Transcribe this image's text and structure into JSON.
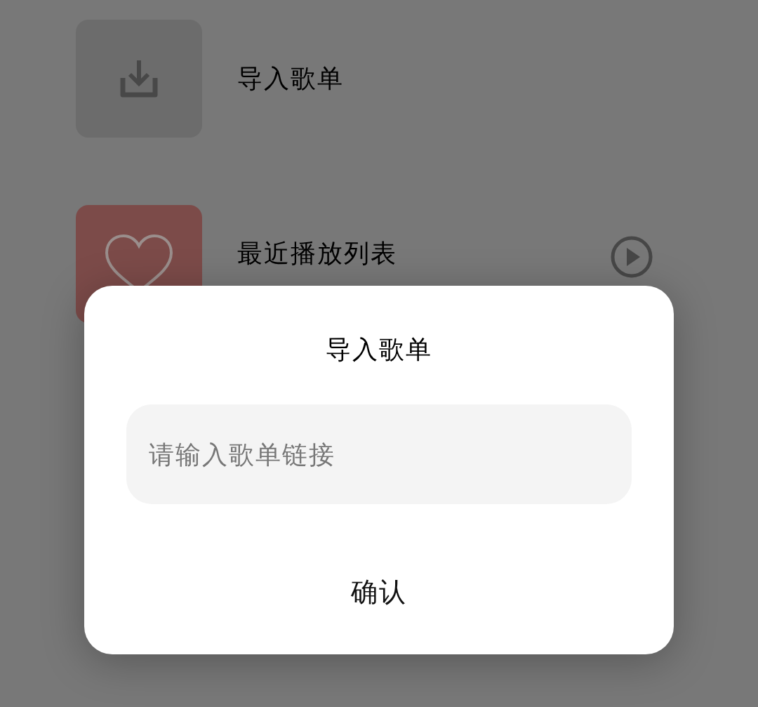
{
  "playlists": [
    {
      "kind": "import",
      "title": "导入歌单"
    },
    {
      "kind": "recent",
      "title": "最近播放列表"
    }
  ],
  "dialog": {
    "title": "导入歌单",
    "input": {
      "placeholder": "请输入歌单链接"
    },
    "confirm_button": "确认"
  }
}
